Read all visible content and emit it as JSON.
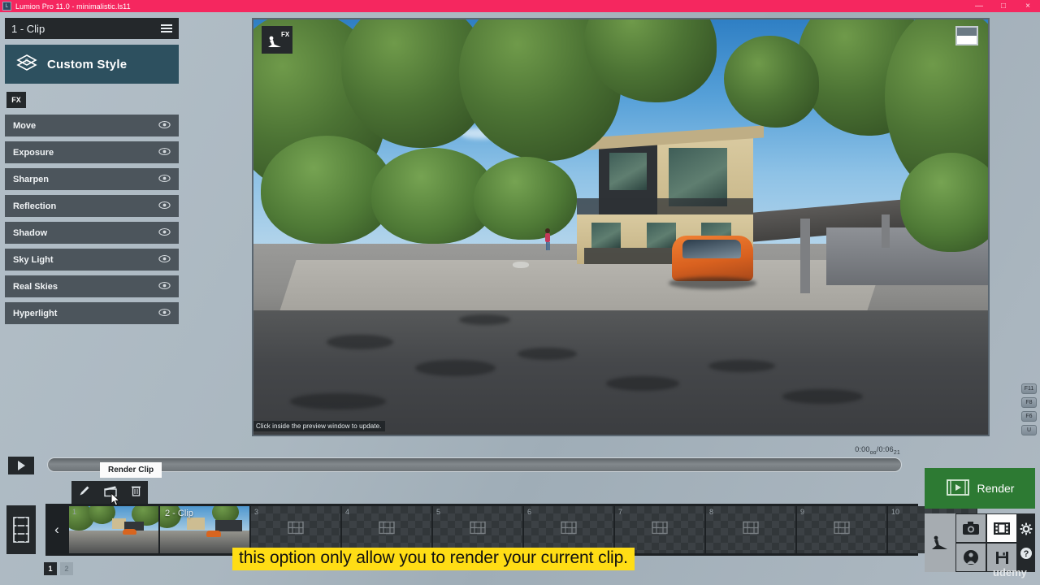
{
  "titlebar": {
    "app_icon": "lumion-app-icon",
    "title": "Lumion Pro 11.0  -  minimalistic.ls11",
    "minimize": "—",
    "maximize": "□",
    "close": "×",
    "accent_color": "#f5275f"
  },
  "left_panel": {
    "clip_header": {
      "label": "1 - Clip",
      "menu_icon": "hamburger-icon"
    },
    "custom_style": {
      "label": "Custom Style",
      "icon": "layers-style-icon",
      "color": "#2d505f"
    },
    "fx_tab": {
      "label": "FX"
    },
    "effects": [
      {
        "label": "Move",
        "visibility_icon": "eye-icon"
      },
      {
        "label": "Exposure",
        "visibility_icon": "eye-icon"
      },
      {
        "label": "Sharpen",
        "visibility_icon": "eye-icon"
      },
      {
        "label": "Reflection",
        "visibility_icon": "eye-icon"
      },
      {
        "label": "Shadow",
        "visibility_icon": "eye-icon"
      },
      {
        "label": "Sky Light",
        "visibility_icon": "eye-icon"
      },
      {
        "label": "Real Skies",
        "visibility_icon": "eye-icon"
      },
      {
        "label": "Hyperlight",
        "visibility_icon": "eye-icon"
      }
    ]
  },
  "viewport": {
    "fx_badge_label": "FX",
    "fx_badge_icon": "worker-construction-icon",
    "corner_widget_icon": "render-preview-toggle-icon",
    "status_text": "Click inside the preview window to update."
  },
  "shortcuts": [
    {
      "label": "F11"
    },
    {
      "label": "F8"
    },
    {
      "label": "F6"
    },
    {
      "label": "U"
    }
  ],
  "timeline": {
    "play_icon": "play-icon",
    "current_time": "0:00",
    "current_frames": "oo",
    "separator": "/",
    "total_time": "0:06",
    "total_frames": "21",
    "scrubber_name": "timeline-scrubber"
  },
  "clip_toolbar": {
    "tooltip": "Render Clip",
    "buttons": [
      {
        "name": "edit-clip-button",
        "icon": "pencil-icon"
      },
      {
        "name": "render-clip-button",
        "icon": "clapperboard-icon"
      },
      {
        "name": "delete-clip-button",
        "icon": "trash-icon"
      }
    ],
    "cursor_icon": "mouse-cursor-icon"
  },
  "filmstrip": {
    "panel_icon": "film-strip-icon",
    "prev_icon": "‹",
    "next_icon": "›",
    "clips": [
      {
        "num": "1",
        "label": "",
        "selected": true,
        "empty": false
      },
      {
        "num": "2",
        "label": "2 - Clip",
        "selected": false,
        "empty": false
      },
      {
        "num": "3",
        "label": "",
        "selected": false,
        "empty": true
      },
      {
        "num": "4",
        "label": "",
        "selected": false,
        "empty": true
      },
      {
        "num": "5",
        "label": "",
        "selected": false,
        "empty": true
      },
      {
        "num": "6",
        "label": "",
        "selected": false,
        "empty": true
      },
      {
        "num": "7",
        "label": "",
        "selected": false,
        "empty": true
      },
      {
        "num": "8",
        "label": "",
        "selected": false,
        "empty": true
      },
      {
        "num": "9",
        "label": "",
        "selected": false,
        "empty": true
      },
      {
        "num": "10",
        "label": "",
        "selected": false,
        "empty": true
      }
    ],
    "pages": [
      {
        "label": "1",
        "active": true
      },
      {
        "label": "2",
        "active": false
      }
    ]
  },
  "render_panel": {
    "render_button": {
      "label": "Render",
      "icon": "film-play-icon",
      "color": "#2d7a33"
    },
    "modes": [
      {
        "name": "build-mode-button",
        "icon": "worker-construction-icon",
        "active": false
      },
      {
        "name": "photo-mode-button",
        "icon": "camera-icon",
        "active": false
      },
      {
        "name": "movie-mode-button",
        "icon": "film-icon",
        "active": true
      },
      {
        "name": "panorama-mode-button",
        "icon": "panorama-person-icon",
        "active": false
      },
      {
        "name": "save-button",
        "icon": "floppy-disk-icon",
        "active": false
      }
    ],
    "side_buttons": [
      {
        "name": "settings-button",
        "icon": "gear-icon"
      },
      {
        "name": "help-button",
        "icon": "question-mark-icon"
      }
    ],
    "watermark": "udemy"
  },
  "subtitle": {
    "text": "this option only allow you to render your current clip."
  }
}
